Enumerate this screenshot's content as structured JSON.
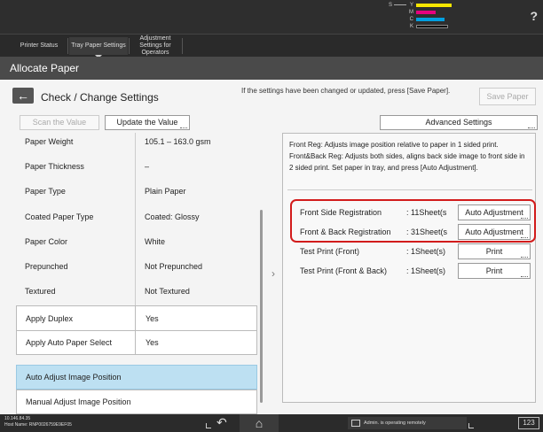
{
  "toner": [
    {
      "label": "Y",
      "color": "#f7e600",
      "width": 40
    },
    {
      "label": "M",
      "color": "#e6007e",
      "width": 22
    },
    {
      "label": "C",
      "color": "#00a0e0",
      "width": 32
    },
    {
      "label": "K",
      "color": "#111111",
      "width": 36
    }
  ],
  "toner_extra_label": "S",
  "header": {
    "help_icon": "?",
    "tabs": [
      {
        "label": "Printer Status"
      },
      {
        "label": "Tray Paper Settings"
      },
      {
        "label": "Adjustment Settings for Operators"
      }
    ]
  },
  "title": "Allocate Paper",
  "page": {
    "back_icon": "left-arrow-icon",
    "heading": "Check / Change Settings",
    "notice": "If the settings have been changed or updated, press [Save Paper].",
    "save_label": "Save Paper",
    "scan_label": "Scan the Value",
    "update_label": "Update the Value",
    "advanced_label": "Advanced Settings"
  },
  "settings": [
    {
      "label": "Paper Weight",
      "value": "105.1 – 163.0 gsm"
    },
    {
      "label": "Paper Thickness",
      "value": "–"
    },
    {
      "label": "Paper Type",
      "value": "Plain Paper"
    },
    {
      "label": "Coated Paper Type",
      "value": "Coated: Glossy"
    },
    {
      "label": "Paper Color",
      "value": "White"
    },
    {
      "label": "Prepunched",
      "value": "Not Prepunched"
    },
    {
      "label": "Textured",
      "value": "Not Textured"
    },
    {
      "label": "Apply Duplex",
      "value": "Yes"
    },
    {
      "label": "Apply Auto Paper Select",
      "value": "Yes"
    }
  ],
  "menu": {
    "auto_adjust": "Auto Adjust Image Position",
    "manual_adjust": "Manual Adjust Image Position"
  },
  "right": {
    "description": "Front Reg: Adjusts image position relative to paper in 1 sided print. Front&Back Reg: Adjusts both sides, aligns back side image to front side in 2 sided print. Set paper in tray, and press [Auto Adjustment].",
    "rows": [
      {
        "label": "Front Side Registration",
        "value": ": 11Sheet(s",
        "button": "Auto Adjustment"
      },
      {
        "label": "Front & Back Registration",
        "value": ": 31Sheet(s",
        "button": "Auto Adjustment"
      },
      {
        "label": "Test Print (Front)",
        "value": ": 1Sheet(s)",
        "button": "Print"
      },
      {
        "label": "Test Print (Front & Back)",
        "value": ": 1Sheet(s)",
        "button": "Print"
      }
    ]
  },
  "footer": {
    "host_ip": "10.146.84.35",
    "host_name": "Host Name: RNP0026759E9EF05",
    "status": "Admin. is operating remotely",
    "counter": "123"
  },
  "colors": {
    "highlight": "#bde0f2",
    "red_outline": "#d21b1b"
  }
}
